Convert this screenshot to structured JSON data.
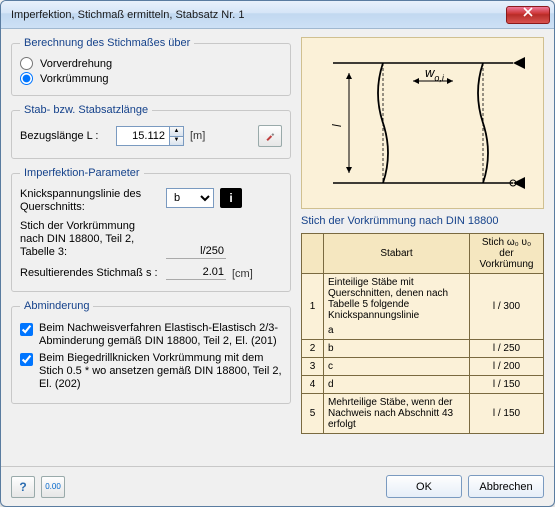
{
  "window": {
    "title": "Imperfektion, Stichmaß ermitteln, Stabsatz Nr. 1"
  },
  "grp_calc": {
    "legend": "Berechnung des Stichmaßes über",
    "opt1": "Vorverdrehung",
    "opt2": "Vorkrümmung"
  },
  "grp_len": {
    "legend": "Stab- bzw. Stabsatzlänge",
    "label": "Bezugslänge L :",
    "value": "15.112",
    "unit": "[m]"
  },
  "grp_param": {
    "legend": "Imperfektion-Parameter",
    "bucklabel": "Knickspannungslinie des Querschnitts:",
    "buckvalue": "b",
    "stich_din_label": "Stich der Vorkrümmung nach DIN 18800, Teil 2, Tabelle 3:",
    "stich_din_value": "l/250",
    "result_label": "Resultierendes Stichmaß s :",
    "result_value": "2.01",
    "result_unit": "[cm]"
  },
  "grp_red": {
    "legend": "Abminderung",
    "c1": "Beim Nachweisverfahren Elastisch-Elastisch 2/3-Abminderung gemäß DIN 18800, Teil 2, El. (201)",
    "c2": "Beim Biegedrillknicken Vorkrümmung mit dem Stich 0.5 * wo ansetzen gemäß DIN 18800, Teil 2, El. (202)"
  },
  "diagram_w": "w",
  "diagram_sub": "o,i",
  "table_caption": "Stich der Vorkrümmung nach DIN 18800",
  "table_h1": "Stabart",
  "table_h2": "Stich ω₀ υ₀ der Vorkrümung",
  "rows": [
    {
      "n": "1",
      "t": "Einteilige Stäbe mit Querschnitten, denen nach Tabelle 5 folgende Knickspannungslinie\na",
      "s": "l / 300"
    },
    {
      "n": "2",
      "t": "b",
      "s": "l / 250"
    },
    {
      "n": "3",
      "t": "c",
      "s": "l / 200"
    },
    {
      "n": "4",
      "t": "d",
      "s": "l / 150"
    },
    {
      "n": "5",
      "t": "Mehrteilige Stäbe, wenn der Nachweis nach Abschnitt 43 erfolgt",
      "s": "l / 150"
    }
  ],
  "footer": {
    "ok": "OK",
    "cancel": "Abbrechen",
    "help": "?",
    "decimals": "0.00"
  }
}
